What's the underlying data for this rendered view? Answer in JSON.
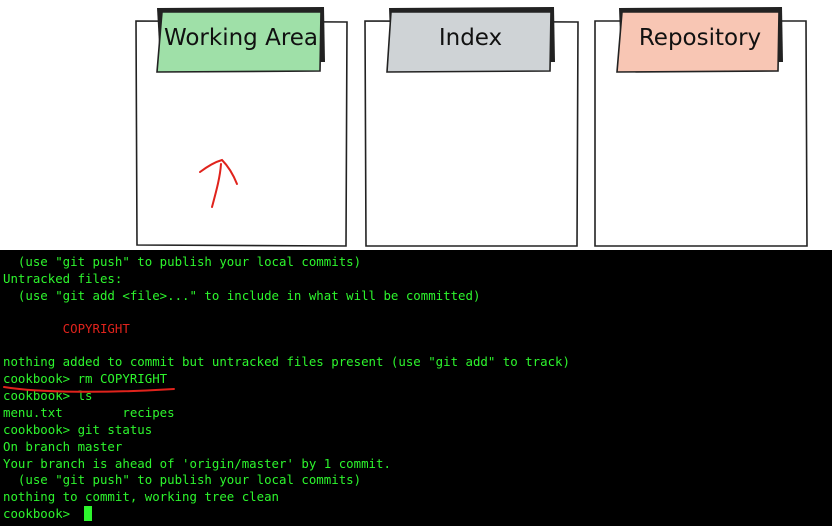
{
  "diagram": {
    "panels": [
      {
        "label": "Working Area",
        "color": "#9fe0a8"
      },
      {
        "label": "Index",
        "color": "#cfd3d6"
      },
      {
        "label": "Repository",
        "color": "#f8c6b4"
      }
    ],
    "annotation_color": "#e0231c"
  },
  "terminal": {
    "text_color": "#2df52d",
    "highlight_color": "#e0231c",
    "lines": [
      "  (use \"git push\" to publish your local commits)",
      "Untracked files:",
      "  (use \"git add <file>...\" to include in what will be committed)",
      "",
      "        COPYRIGHT",
      "",
      "nothing added to commit but untracked files present (use \"git add\" to track)",
      "cookbook> rm COPYRIGHT",
      "cookbook> ls",
      "menu.txt        recipes",
      "cookbook> git status",
      "On branch master",
      "Your branch is ahead of 'origin/master' by 1 commit.",
      "  (use \"git push\" to publish your local commits)",
      "nothing to commit, working tree clean",
      "cookbook> "
    ]
  }
}
